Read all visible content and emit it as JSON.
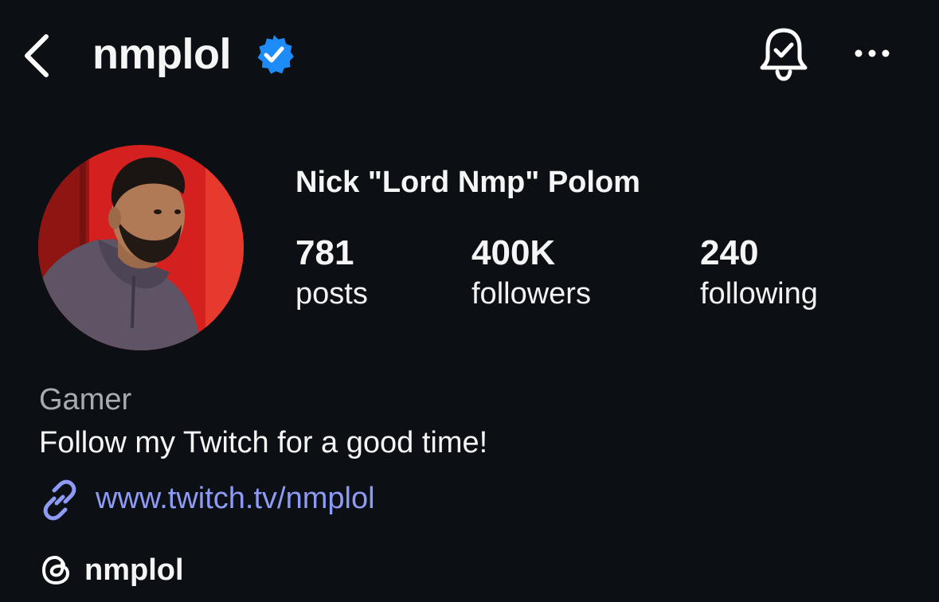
{
  "header": {
    "username": "nmplol",
    "verified": true,
    "icons": {
      "back": "chevron-left-icon",
      "verified": "verified-badge-icon",
      "notifications": "bell-check-icon",
      "more": "more-horizontal-icon"
    }
  },
  "profile": {
    "display_name": "Nick \"Lord Nmp\" Polom",
    "stats": {
      "posts": {
        "value": "781",
        "label": "posts"
      },
      "followers": {
        "value": "400K",
        "label": "followers"
      },
      "following": {
        "value": "240",
        "label": "following"
      }
    },
    "category": "Gamer",
    "bio": "Follow my Twitch for a good time!",
    "link": {
      "text": "www.twitch.tv/nmplol",
      "icon": "link-icon"
    },
    "threads": {
      "handle": "nmplol",
      "icon": "threads-icon"
    }
  },
  "colors": {
    "background": "#0c0f14",
    "text": "#f5f5f5",
    "muted": "#a8abb2",
    "link": "#8e9bf5",
    "verified": "#1d8cf8",
    "avatar_bg": "#d4201e"
  }
}
